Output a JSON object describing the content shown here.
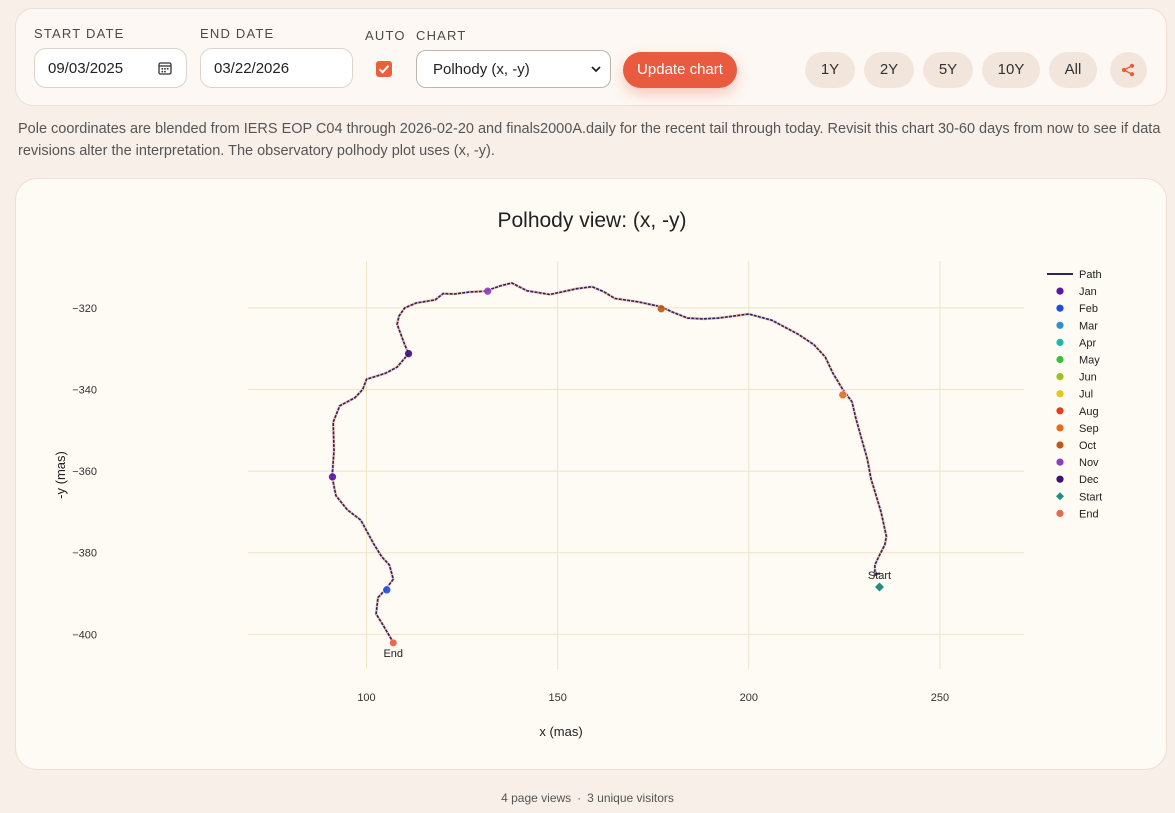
{
  "controls": {
    "start_label": "START DATE",
    "start_value": "09/03/2025",
    "end_label": "END DATE",
    "end_value": "03/22/2026",
    "auto_label": "AUTO",
    "auto_checked": true,
    "chart_label": "CHART",
    "chart_selected": "Polhody (x, -y)",
    "update_label": "Update chart",
    "ranges": [
      "1Y",
      "2Y",
      "5Y",
      "10Y",
      "All"
    ],
    "share_icon": "share-icon",
    "accent_color": "#e85b3f"
  },
  "note": "Pole coordinates are blended from IERS EOP C04 through 2026-02-20 and finals2000A.daily for the recent tail through today. Revisit this chart 30-60 days from now to see if data revisions alter the interpretation. The observatory polhody plot uses (x, -y).",
  "chart_data": {
    "type": "line",
    "title": "Polhody view: (x, -y)",
    "xlabel": "x (mas)",
    "ylabel": "-y (mas)",
    "xlim": [
      69,
      272
    ],
    "ylim": [
      -408.5,
      -308.5
    ],
    "xticks": [
      100,
      150,
      200,
      250
    ],
    "yticks": [
      -320,
      -340,
      -360,
      -380,
      -400
    ],
    "ytick_labels": [
      "−320",
      "−340",
      "−360",
      "−380",
      "−400"
    ],
    "grid": true,
    "legend_position": "right",
    "path": {
      "name": "Path",
      "color": "#2e2560",
      "points": [
        [
          234.3,
          -385.0
        ],
        [
          233.0,
          -385.5
        ],
        [
          233.0,
          -383.0
        ],
        [
          234.0,
          -381.0
        ],
        [
          235.6,
          -378.0
        ],
        [
          236.0,
          -376.0
        ],
        [
          234.6,
          -370.0
        ],
        [
          233.0,
          -365.0
        ],
        [
          232.0,
          -362.0
        ],
        [
          231.0,
          -357.0
        ],
        [
          229.5,
          -352.0
        ],
        [
          228.0,
          -347.0
        ],
        [
          227.0,
          -343.0
        ],
        [
          224.6,
          -340.0
        ],
        [
          222.0,
          -336.0
        ],
        [
          220.0,
          -332.0
        ],
        [
          217.0,
          -329.0
        ],
        [
          213.0,
          -326.5
        ],
        [
          206.0,
          -323.0
        ],
        [
          200.0,
          -321.5
        ],
        [
          196.0,
          -322.0
        ],
        [
          192.0,
          -322.5
        ],
        [
          188.0,
          -322.7
        ],
        [
          184.0,
          -322.5
        ],
        [
          180.0,
          -321.0
        ],
        [
          177.0,
          -319.7
        ],
        [
          171.0,
          -318.5
        ],
        [
          165.0,
          -317.7
        ],
        [
          162.0,
          -316.0
        ],
        [
          159.0,
          -314.8
        ],
        [
          155.0,
          -315.3
        ],
        [
          148.0,
          -316.7
        ],
        [
          142.0,
          -315.8
        ],
        [
          138.0,
          -313.9
        ],
        [
          135.0,
          -314.6
        ],
        [
          131.0,
          -315.9
        ],
        [
          127.0,
          -316.1
        ],
        [
          123.0,
          -316.6
        ],
        [
          120.0,
          -316.5
        ],
        [
          118.0,
          -318.0
        ],
        [
          113.0,
          -318.8
        ],
        [
          110.0,
          -320.0
        ],
        [
          108.5,
          -322.0
        ],
        [
          108.0,
          -324.0
        ],
        [
          109.0,
          -326.5
        ],
        [
          110.0,
          -329.0
        ],
        [
          111.0,
          -331.2
        ],
        [
          108.0,
          -334.5
        ],
        [
          105.0,
          -336.0
        ],
        [
          100.0,
          -337.5
        ],
        [
          99.0,
          -340.0
        ],
        [
          97.0,
          -342.0
        ],
        [
          93.0,
          -344.0
        ],
        [
          91.3,
          -348.0
        ],
        [
          91.5,
          -355.0
        ],
        [
          91.0,
          -361.4
        ],
        [
          92.0,
          -366.0
        ],
        [
          95.0,
          -369.5
        ],
        [
          98.5,
          -372.0
        ],
        [
          102.0,
          -378.0
        ],
        [
          104.0,
          -381.0
        ],
        [
          106.0,
          -383.0
        ],
        [
          107.0,
          -386.5
        ],
        [
          105.0,
          -389.0
        ],
        [
          103.0,
          -391.0
        ],
        [
          102.5,
          -395.0
        ],
        [
          104.5,
          -398.0
        ],
        [
          107.0,
          -402.0
        ]
      ]
    },
    "month_markers": [
      {
        "label": "Sep",
        "x": 224.6,
        "y": -341.3
      },
      {
        "label": "Oct",
        "x": 177.1,
        "y": -320.2
      },
      {
        "label": "Nov",
        "x": 131.7,
        "y": -315.9
      },
      {
        "label": "Dec",
        "x": 111.0,
        "y": -331.2
      },
      {
        "label": "Jan",
        "x": 91.1,
        "y": -361.4
      },
      {
        "label": "Feb",
        "x": 105.3,
        "y": -389.1
      }
    ],
    "start_point": {
      "label": "Start",
      "x": 234.2,
      "y": -388.4
    },
    "end_point": {
      "label": "End",
      "x": 107.0,
      "y": -402.1
    },
    "legend": [
      {
        "label": "Path",
        "color": "#2e2560",
        "marker": "line"
      },
      {
        "label": "Jan",
        "color": "#5b17a8",
        "marker": "dot"
      },
      {
        "label": "Feb",
        "color": "#1d4ee0",
        "marker": "dot"
      },
      {
        "label": "Mar",
        "color": "#2d8fd6",
        "marker": "dot"
      },
      {
        "label": "Apr",
        "color": "#1fb8a8",
        "marker": "dot"
      },
      {
        "label": "May",
        "color": "#3cbf3c",
        "marker": "dot"
      },
      {
        "label": "Jun",
        "color": "#9dc21d",
        "marker": "dot"
      },
      {
        "label": "Jul",
        "color": "#e8c51a",
        "marker": "dot"
      },
      {
        "label": "Aug",
        "color": "#e0401a",
        "marker": "dot"
      },
      {
        "label": "Sep",
        "color": "#e86a1a",
        "marker": "dot"
      },
      {
        "label": "Oct",
        "color": "#c4560f",
        "marker": "dot"
      },
      {
        "label": "Nov",
        "color": "#8a3ec0",
        "marker": "dot"
      },
      {
        "label": "Dec",
        "color": "#3d137a",
        "marker": "dot"
      },
      {
        "label": "Start",
        "color": "#1f8f7e",
        "marker": "diamond"
      },
      {
        "label": "End",
        "color": "#e86a4f",
        "marker": "dot"
      }
    ]
  },
  "footer": {
    "page_views": "4 page views",
    "unique_visitors": "3 unique visitors"
  }
}
